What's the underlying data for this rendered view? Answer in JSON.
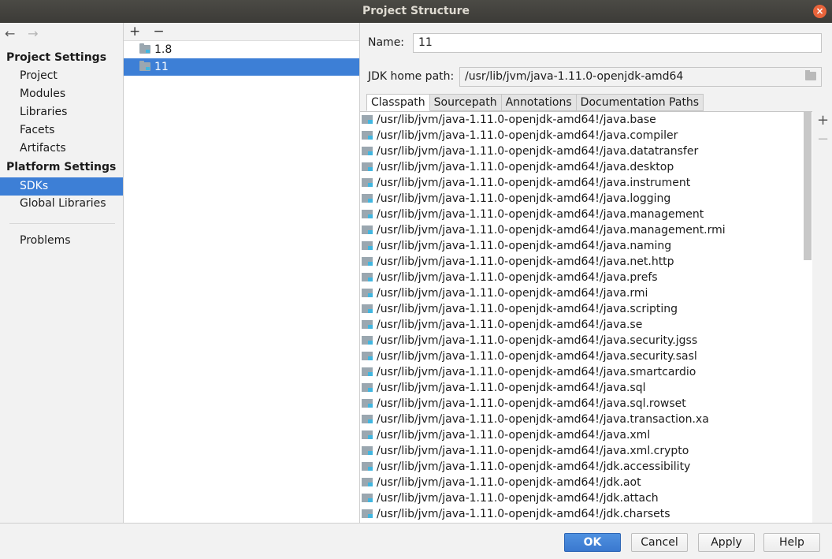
{
  "window": {
    "title": "Project Structure",
    "close_glyph": "×"
  },
  "nav": {
    "back_glyph": "←",
    "forward_glyph": "→",
    "project_settings_header": "Project Settings",
    "project_items": [
      "Project",
      "Modules",
      "Libraries",
      "Facets",
      "Artifacts"
    ],
    "platform_settings_header": "Platform Settings",
    "platform_items": [
      "SDKs",
      "Global Libraries"
    ],
    "selected": "SDKs",
    "problems": "Problems"
  },
  "sdk_list": {
    "add_glyph": "+",
    "remove_glyph": "−",
    "items": [
      "1.8",
      "11"
    ],
    "selected": "11"
  },
  "detail": {
    "name_label": "Name:",
    "name_value": "11",
    "jdk_home_label": "JDK home path:",
    "jdk_home_value": "/usr/lib/jvm/java-1.11.0-openjdk-amd64",
    "tabs": [
      "Classpath",
      "Sourcepath",
      "Annotations",
      "Documentation Paths"
    ],
    "active_tab": "Classpath",
    "side_add": "+",
    "side_remove": "−",
    "paths": [
      "/usr/lib/jvm/java-1.11.0-openjdk-amd64!/java.base",
      "/usr/lib/jvm/java-1.11.0-openjdk-amd64!/java.compiler",
      "/usr/lib/jvm/java-1.11.0-openjdk-amd64!/java.datatransfer",
      "/usr/lib/jvm/java-1.11.0-openjdk-amd64!/java.desktop",
      "/usr/lib/jvm/java-1.11.0-openjdk-amd64!/java.instrument",
      "/usr/lib/jvm/java-1.11.0-openjdk-amd64!/java.logging",
      "/usr/lib/jvm/java-1.11.0-openjdk-amd64!/java.management",
      "/usr/lib/jvm/java-1.11.0-openjdk-amd64!/java.management.rmi",
      "/usr/lib/jvm/java-1.11.0-openjdk-amd64!/java.naming",
      "/usr/lib/jvm/java-1.11.0-openjdk-amd64!/java.net.http",
      "/usr/lib/jvm/java-1.11.0-openjdk-amd64!/java.prefs",
      "/usr/lib/jvm/java-1.11.0-openjdk-amd64!/java.rmi",
      "/usr/lib/jvm/java-1.11.0-openjdk-amd64!/java.scripting",
      "/usr/lib/jvm/java-1.11.0-openjdk-amd64!/java.se",
      "/usr/lib/jvm/java-1.11.0-openjdk-amd64!/java.security.jgss",
      "/usr/lib/jvm/java-1.11.0-openjdk-amd64!/java.security.sasl",
      "/usr/lib/jvm/java-1.11.0-openjdk-amd64!/java.smartcardio",
      "/usr/lib/jvm/java-1.11.0-openjdk-amd64!/java.sql",
      "/usr/lib/jvm/java-1.11.0-openjdk-amd64!/java.sql.rowset",
      "/usr/lib/jvm/java-1.11.0-openjdk-amd64!/java.transaction.xa",
      "/usr/lib/jvm/java-1.11.0-openjdk-amd64!/java.xml",
      "/usr/lib/jvm/java-1.11.0-openjdk-amd64!/java.xml.crypto",
      "/usr/lib/jvm/java-1.11.0-openjdk-amd64!/jdk.accessibility",
      "/usr/lib/jvm/java-1.11.0-openjdk-amd64!/jdk.aot",
      "/usr/lib/jvm/java-1.11.0-openjdk-amd64!/jdk.attach",
      "/usr/lib/jvm/java-1.11.0-openjdk-amd64!/jdk.charsets"
    ]
  },
  "buttons": {
    "ok": "OK",
    "cancel": "Cancel",
    "apply": "Apply",
    "help": "Help"
  }
}
